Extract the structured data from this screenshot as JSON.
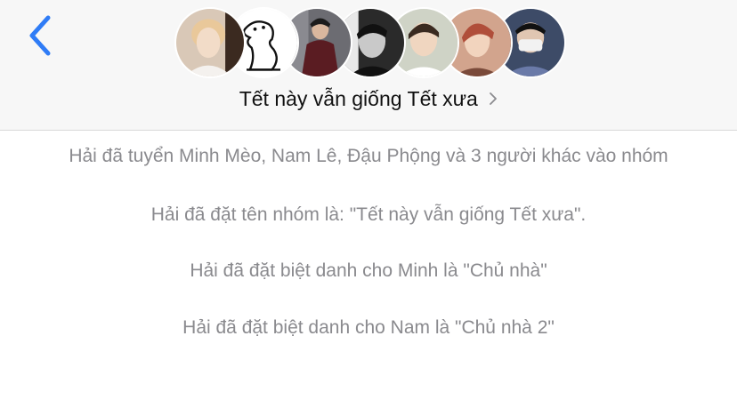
{
  "header": {
    "title": "Tết này vẫn giống Tết xưa",
    "back_icon": "chevron-left-icon",
    "title_icon": "chevron-right-icon",
    "accent_color": "#2f7cf6",
    "members": [
      {
        "avatar": "profile-photo",
        "bg": "#d9c8b7"
      },
      {
        "avatar": "doodle-character",
        "bg": "#ffffff"
      },
      {
        "avatar": "profile-photo",
        "bg": "#6c6c72"
      },
      {
        "avatar": "profile-photo",
        "bg": "#2a2a2a"
      },
      {
        "avatar": "profile-photo",
        "bg": "#cfd3c6"
      },
      {
        "avatar": "profile-photo",
        "bg": "#d2a48d"
      },
      {
        "avatar": "profile-photo",
        "bg": "#3d4b67"
      }
    ]
  },
  "events": [
    "Hải đã tuyển Minh Mèo, Nam Lê, Đậu Phộng và 3 người khác vào nhóm",
    "Hải đã đặt tên nhóm là: \"Tết này vẫn giống Tết xưa\".",
    "Hải đã đặt biệt danh cho Minh là \"Chủ nhà\"",
    "Hải đã đặt biệt danh cho Nam là \"Chủ nhà 2\""
  ]
}
